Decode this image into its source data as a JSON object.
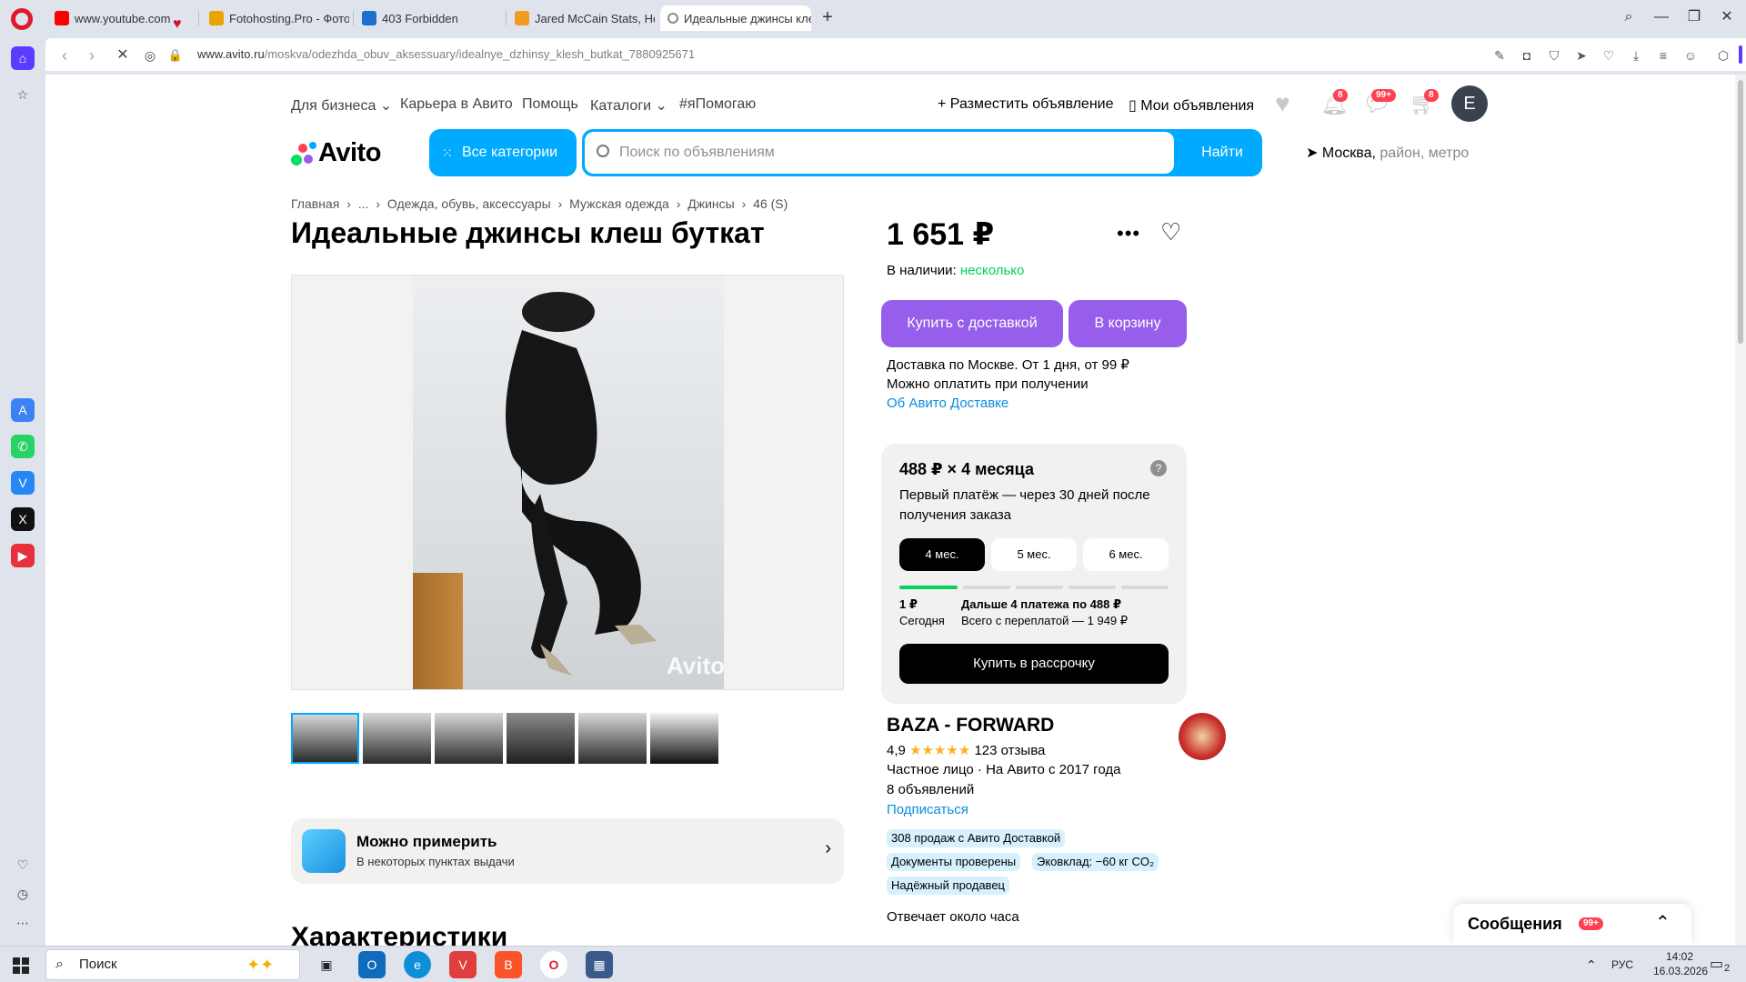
{
  "browser": {
    "tabs": [
      {
        "label": "www.youtube.com",
        "fav_color": "#ff0000"
      },
      {
        "label": "Fotohosting.Pro - Фотохо",
        "fav_color": "#e8a300"
      },
      {
        "label": "403 Forbidden",
        "fav_color": "#1f6fd1"
      },
      {
        "label": "Jared McCain Stats, Heigh",
        "fav_color": "#f29c1f"
      },
      {
        "label": "Идеальные джинсы клеш",
        "fav_color": "#888888"
      }
    ],
    "url_host": "www.avito.ru",
    "url_path": "/moskva/odezhda_obuv_aksessuary/idealnye_dzhinsy_klesh_butkat_7880925671"
  },
  "header": {
    "top_links": [
      "Для бизнеса",
      "Карьера в Авито",
      "Помощь",
      "Каталоги",
      "#яПомогаю"
    ],
    "post_ad": "Разместить объявление",
    "my_ads": "Мои объявления",
    "notif_count": "8",
    "messages_count": "99+",
    "cart_count": "8",
    "avatar_letter": "E",
    "logo": "Avito",
    "all_categories": "Все категории",
    "search_placeholder": "Поиск по объявлениям",
    "search_button": "Найти",
    "location_city": "Москва,",
    "location_hint": "район, метро"
  },
  "breadcrumb": [
    "Главная",
    "›",
    "...",
    "›",
    "Одежда, обувь, аксессуары",
    "›",
    "Мужская одежда",
    "›",
    "Джинсы",
    "›",
    "46 (S)"
  ],
  "listing": {
    "title": "Идеальные джинсы клеш буткат",
    "watermark": "Avito",
    "thumb_count": 6,
    "try_on_title": "Можно примерить",
    "try_on_sub": "В некоторых пунктах выдачи",
    "characteristics": "Характеристики"
  },
  "purchase": {
    "price": "1 651 ₽",
    "stock_label": "В наличии:",
    "stock_value": "несколько",
    "buy_delivery": "Купить с доставкой",
    "to_cart": "В корзину",
    "delivery_line1": "Доставка по Москве. От 1 дня, от 99 ₽",
    "delivery_line2": "Можно оплатить при получении",
    "delivery_link": "Об Авито Доставке"
  },
  "installment": {
    "headline": "488 ₽ × 4 месяца",
    "desc": "Первый платёж — через 30 дней после получения заказа",
    "terms": [
      "4 мес.",
      "5 мес.",
      "6 мес."
    ],
    "selected_term": 0,
    "first_amount": "1 ₽",
    "first_when": "Сегодня",
    "next_payments": "Дальше 4 платежа по 488 ₽",
    "total": "Всего с переплатой — 1 949 ₽",
    "button": "Купить в рассрочку"
  },
  "seller": {
    "name": "BAZA - FORWARD",
    "rating": "4,9",
    "stars": "★★★★★",
    "reviews": "123 отзыва",
    "type_line": "Частное лицо · На Авито с 2017 года",
    "ads_count": "8 объявлений",
    "subscribe": "Подписаться",
    "chips": [
      "308 продаж с Авито Доставкой",
      "Документы проверены",
      "Эковклад: −60 кг CO₂",
      "Надёжный продавец"
    ],
    "reply": "Отвечает около часа"
  },
  "messages_panel": {
    "title": "Сообщения",
    "badge": "99+"
  },
  "taskbar": {
    "search": "Поиск",
    "lang": "РУС",
    "time": "14:02",
    "date": "16.03.2026",
    "notif": "2"
  }
}
